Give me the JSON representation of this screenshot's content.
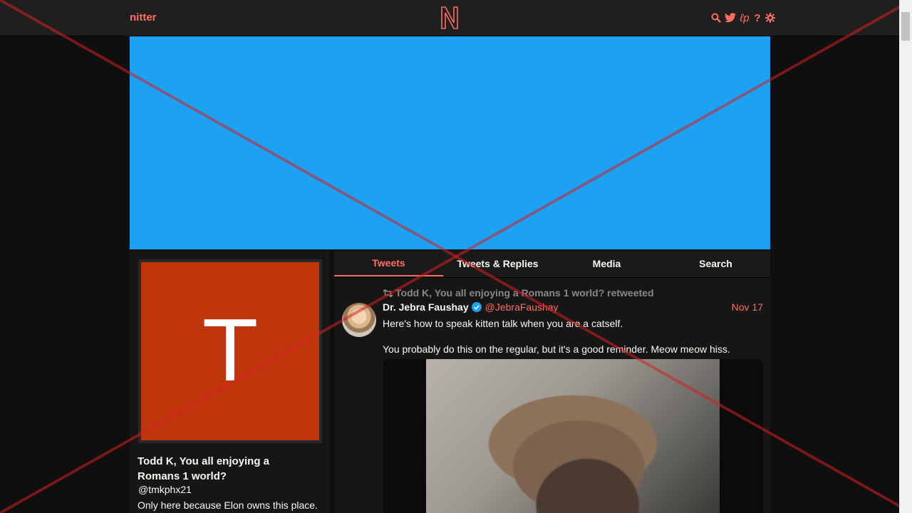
{
  "nav": {
    "brand": "nitter",
    "logo": "N",
    "icons": [
      "search-icon",
      "twitter-icon",
      "lp-icon",
      "help-icon",
      "gear-icon"
    ],
    "lp_text": "ℓp",
    "help_text": "?"
  },
  "colors": {
    "accent": "#ff6c60",
    "banner": "#1da1f2",
    "avatar_bg": "#bf360c",
    "page_bg": "#0f0f0f"
  },
  "profile": {
    "avatar_letter": "T",
    "fullname": "Todd K, You all enjoying a Romans 1 world?",
    "username": "@tmkphx21",
    "bio": "Only here because Elon owns this place."
  },
  "tabs": [
    {
      "label": "Tweets",
      "active": true
    },
    {
      "label": "Tweets & Replies",
      "active": false
    },
    {
      "label": "Media",
      "active": false
    },
    {
      "label": "Search",
      "active": false
    }
  ],
  "tweet": {
    "retweet_header": "Todd K, You all enjoying a Romans 1 world? retweeted",
    "author_name": "Dr. Jebra Faushay",
    "author_handle": "@JebraFaushay",
    "date": "Nov 17",
    "text": [
      "Here's how to speak kitten talk when you are a catself.",
      "You probably do this on the regular, but it's a good reminder. Meow meow hiss."
    ]
  }
}
